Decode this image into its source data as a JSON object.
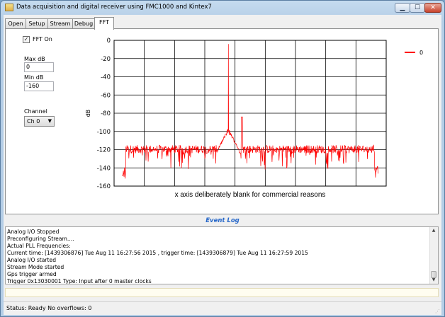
{
  "window": {
    "title": "Data acquisition and digital receiver using FMC1000 and Kintex7",
    "controls": {
      "minimize": "▁",
      "maximize": "☐",
      "close": "✕"
    }
  },
  "tabs": [
    {
      "label": "Open",
      "active": false
    },
    {
      "label": "Setup",
      "active": false
    },
    {
      "label": "Stream",
      "active": false
    },
    {
      "label": "Debug",
      "active": false
    },
    {
      "label": "FFT",
      "active": true
    }
  ],
  "fft_panel": {
    "fft_on_label": "FFT On",
    "fft_on_checked": true,
    "max_db_label": "Max dB",
    "max_db_value": "0",
    "min_db_label": "Min dB",
    "min_db_value": "-160",
    "channel_label": "Channel",
    "channel_value": "Ch 0"
  },
  "chart_data": {
    "type": "line",
    "title": "",
    "xlabel": "x axis deliberately blank for commercial reasons",
    "ylabel": "dB",
    "ylim": [
      -160,
      0
    ],
    "yticks": [
      0,
      -20,
      -40,
      -60,
      -80,
      -100,
      -120,
      -140,
      -160
    ],
    "grid": true,
    "legend_placement": "top-right",
    "series": [
      {
        "name": "0",
        "color": "#ff0000",
        "noise_floor_db": [
          -124,
          -133
        ],
        "noise_dips_to_db": -158,
        "main_peak": {
          "x_fraction": 0.42,
          "value_db": -4
        },
        "secondary_peak": {
          "x_fraction": 0.47,
          "value_db": -84
        },
        "spur_db": -95,
        "span_fraction": [
          0.03,
          0.97
        ]
      }
    ]
  },
  "event_log": {
    "title": "Event Log",
    "lines": [
      "Analog I/O Stopped",
      "Preconfiguring Stream....",
      "Actual PLL Frequencies:",
      "Current time: [1439306876] Tue Aug 11 16:27:56 2015 , trigger time: [1439306879] Tue Aug 11 16:27:59 2015",
      "Analog I/O started",
      "Stream Mode started",
      "Gps trigger armed",
      "Trigger 0x13030001 Type: Input  after 0 master clocks"
    ]
  },
  "status": {
    "text": "Status: Ready  No overflows: 0"
  }
}
